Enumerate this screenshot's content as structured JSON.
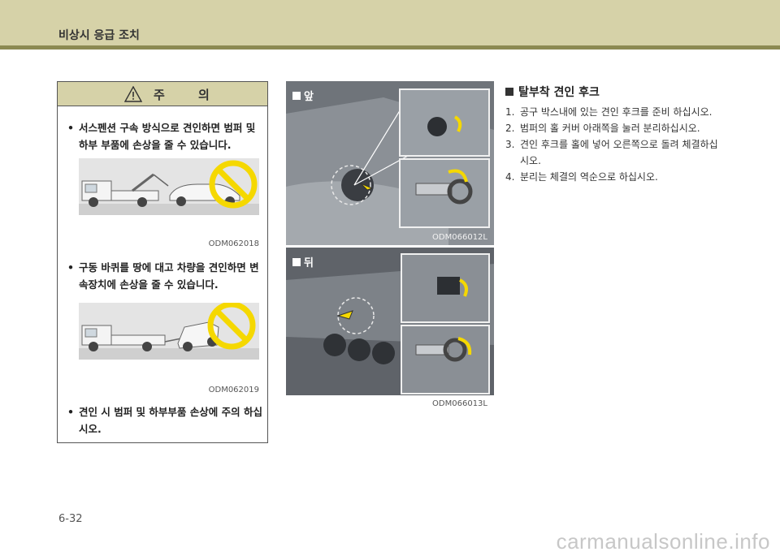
{
  "header": {
    "title": "비상시 응급 조치"
  },
  "caution": {
    "title": "주 의",
    "bullets": [
      "서스펜션 구속 방식으로 견인하면 범퍼 및 하부 부품에 손상을 줄 수 있습니다.",
      "구동 바퀴를 땅에 대고 차량을 견인하면 변속장치에 손상을 줄 수 있습니다.",
      "견인 시 범퍼 및 하부부품 손상에 주의 하십시오."
    ],
    "image_codes": [
      "ODM062018",
      "ODM062019"
    ]
  },
  "photos": [
    {
      "label": "앞",
      "code": "ODM066012L"
    },
    {
      "label": "뒤",
      "code": "ODM066013L"
    }
  ],
  "section": {
    "title": "탈부착 견인 후크",
    "steps": [
      {
        "num": "1.",
        "text": "공구 박스내에 있는 견인 후크를 준비 하십시오."
      },
      {
        "num": "2.",
        "text": "범퍼의 홀 커버 아래쪽을 눌러 분리하십시오."
      },
      {
        "num": "3.",
        "text": "견인 후크를 홀에 넣어 오른쪽으로 돌려 체결하십시오."
      },
      {
        "num": "4.",
        "text": "분리는 체결의 역순으로 하십시오."
      }
    ]
  },
  "page_number": "6-32",
  "watermark": "carmanualsonline.info",
  "colors": {
    "header_band": "#d6d2a8",
    "header_strip": "#8c8a52",
    "prohibit": "#f5d800"
  }
}
